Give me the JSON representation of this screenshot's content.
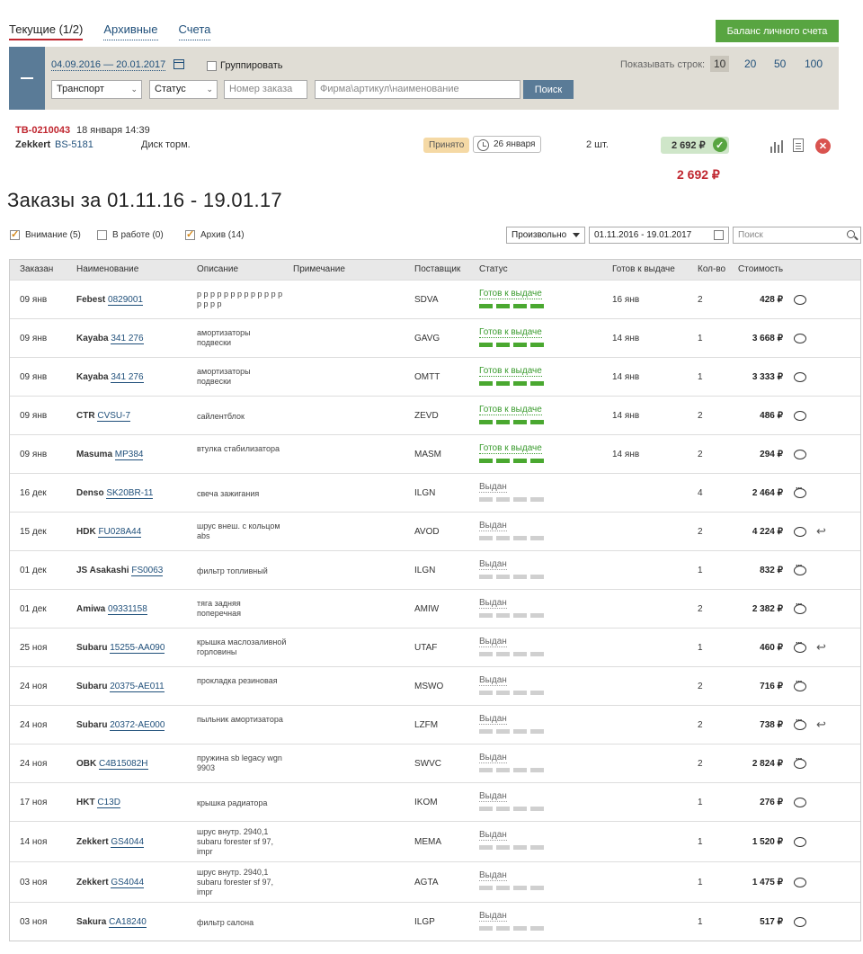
{
  "tabs": [
    {
      "label": "Текущие (1/2)",
      "active": true
    },
    {
      "label": "Архивные",
      "active": false
    },
    {
      "label": "Счета",
      "active": false
    }
  ],
  "balance_button": "Баланс личного счета",
  "filter": {
    "date_range": "04.09.2016 — 20.01.2017",
    "group_label": "Группировать",
    "rows_label": "Показывать строк:",
    "rows_options": [
      "10",
      "20",
      "50",
      "100"
    ],
    "rows_selected": "10",
    "transport_select": "Транспорт",
    "status_select": "Статус",
    "order_number_placeholder": "Номер заказа",
    "firm_placeholder": "Фирма\\артикул\\наименование",
    "search_button": "Поиск"
  },
  "current_order": {
    "code": "ТВ-0210043",
    "date": "18 января 14:39",
    "brand": "Zekkert",
    "article": "BS-5181",
    "description": "Диск торм.",
    "status": "Принято",
    "delivery": "26 января",
    "qty": "2 шт.",
    "price": "2 692 ₽",
    "total": "2 692 ₽"
  },
  "heading": "Заказы за 01.11.16 - 19.01.17",
  "list_filters": {
    "attention": {
      "label": "Внимание (5)",
      "checked": true
    },
    "in_work": {
      "label": "В работе (0)",
      "checked": false
    },
    "archive": {
      "label": "Архив (14)",
      "checked": true
    },
    "period": "Произвольно",
    "period_dates": "01.11.2016 - 19.01.2017",
    "search_placeholder": "Поиск"
  },
  "columns": [
    "Заказан",
    "Наименование",
    "Описание",
    "Примечание",
    "Поставщик",
    "Статус",
    "Готов к выдаче",
    "Кол-во",
    "Стоимость"
  ],
  "rows": [
    {
      "date": "09 янв",
      "brand": "Febest",
      "article": "0829001",
      "desc": "р р р р р р р р р р р р р р р р р",
      "supplier": "SDVA",
      "status": "Готов к выдаче",
      "ready": "16 янв",
      "qty": "2",
      "cost": "428 ₽",
      "comment": "empty",
      "ret": false
    },
    {
      "date": "09 янв",
      "brand": "Kayaba",
      "article": "341 276",
      "desc": "амортизаторы подвески",
      "supplier": "GAVG",
      "status": "Готов к выдаче",
      "ready": "14 янв",
      "qty": "1",
      "cost": "3 668 ₽",
      "comment": "empty",
      "ret": false
    },
    {
      "date": "09 янв",
      "brand": "Kayaba",
      "article": "341 276",
      "desc": "амортизаторы подвески",
      "supplier": "OMTT",
      "status": "Готов к выдаче",
      "ready": "14 янв",
      "qty": "1",
      "cost": "3 333 ₽",
      "comment": "empty",
      "ret": false
    },
    {
      "date": "09 янв",
      "brand": "CTR",
      "article": "CVSU-7",
      "desc": "сайлентблок",
      "supplier": "ZEVD",
      "status": "Готов к выдаче",
      "ready": "14 янв",
      "qty": "2",
      "cost": "486 ₽",
      "comment": "empty",
      "ret": false
    },
    {
      "date": "09 янв",
      "brand": "Masuma",
      "article": "MP384",
      "desc": "втулка стабилизатора",
      "supplier": "MASM",
      "status": "Готов к выдаче",
      "ready": "14 янв",
      "qty": "2",
      "cost": "294 ₽",
      "comment": "empty",
      "ret": false
    },
    {
      "date": "16 дек",
      "brand": "Denso",
      "article": "SK20BR-11",
      "desc": "свеча зажигания",
      "supplier": "ILGN",
      "status": "Выдан",
      "ready": "",
      "qty": "4",
      "cost": "2 464 ₽",
      "comment": "filled",
      "ret": false
    },
    {
      "date": "15 дек",
      "brand": "HDK",
      "article": "FU028A44",
      "desc": "шрус внеш. с кольцом abs",
      "supplier": "AVOD",
      "status": "Выдан",
      "ready": "",
      "qty": "2",
      "cost": "4 224 ₽",
      "comment": "empty",
      "ret": true
    },
    {
      "date": "01 дек",
      "brand": "JS Asakashi",
      "article": "FS0063",
      "desc": "фильтр топливный",
      "supplier": "ILGN",
      "status": "Выдан",
      "ready": "",
      "qty": "1",
      "cost": "832 ₽",
      "comment": "filled",
      "ret": false
    },
    {
      "date": "01 дек",
      "brand": "Amiwa",
      "article": "09331158",
      "desc": "тяга задняя поперечная",
      "supplier": "AMIW",
      "status": "Выдан",
      "ready": "",
      "qty": "2",
      "cost": "2 382 ₽",
      "comment": "filled",
      "ret": false
    },
    {
      "date": "25 ноя",
      "brand": "Subaru",
      "article": "15255-AA090",
      "desc": "крышка маслозаливной горловины",
      "supplier": "UTAF",
      "status": "Выдан",
      "ready": "",
      "qty": "1",
      "cost": "460 ₽",
      "comment": "filled",
      "ret": true
    },
    {
      "date": "24 ноя",
      "brand": "Subaru",
      "article": "20375-AE011",
      "desc": "прокладка резиновая",
      "supplier": "MSWO",
      "status": "Выдан",
      "ready": "",
      "qty": "2",
      "cost": "716 ₽",
      "comment": "filled",
      "ret": false
    },
    {
      "date": "24 ноя",
      "brand": "Subaru",
      "article": "20372-AE000",
      "desc": "пыльник амортизатора",
      "supplier": "LZFM",
      "status": "Выдан",
      "ready": "",
      "qty": "2",
      "cost": "738 ₽",
      "comment": "filled",
      "ret": true
    },
    {
      "date": "24 ноя",
      "brand": "OBK",
      "article": "C4B15082H",
      "desc": "пружина sb legacy wgn 9903",
      "supplier": "SWVC",
      "status": "Выдан",
      "ready": "",
      "qty": "2",
      "cost": "2 824 ₽",
      "comment": "filled",
      "ret": false
    },
    {
      "date": "17 ноя",
      "brand": "HKT",
      "article": "C13D",
      "desc": "крышка радиатора",
      "supplier": "IKOM",
      "status": "Выдан",
      "ready": "",
      "qty": "1",
      "cost": "276 ₽",
      "comment": "empty",
      "ret": false
    },
    {
      "date": "14 ноя",
      "brand": "Zekkert",
      "article": "GS4044",
      "desc": "шрус внутр. 2940,1 subaru forester sf 97, impr",
      "supplier": "MEMA",
      "status": "Выдан",
      "ready": "",
      "qty": "1",
      "cost": "1 520 ₽",
      "comment": "empty",
      "ret": false
    },
    {
      "date": "03 ноя",
      "brand": "Zekkert",
      "article": "GS4044",
      "desc": "шрус внутр. 2940,1 subaru forester sf 97, impr",
      "supplier": "AGTA",
      "status": "Выдан",
      "ready": "",
      "qty": "1",
      "cost": "1 475 ₽",
      "comment": "empty",
      "ret": false
    },
    {
      "date": "03 ноя",
      "brand": "Sakura",
      "article": "CA18240",
      "desc": "фильтр салона",
      "supplier": "ILGP",
      "status": "Выдан",
      "ready": "",
      "qty": "1",
      "cost": "517 ₽",
      "comment": "empty",
      "ret": false
    }
  ]
}
